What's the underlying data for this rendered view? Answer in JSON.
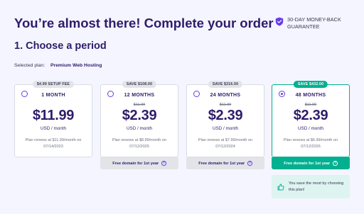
{
  "header": {
    "title": "You’re almost there! Complete your order",
    "guarantee_text": "30-DAY MONEY-BACK GUARANTEE"
  },
  "section": {
    "title": "1. Choose a period",
    "selected_plan_label": "Selected plan:",
    "selected_plan_name": "Premium Web Hosting"
  },
  "plans": [
    {
      "badge": "$4.99 SETUP FEE",
      "period": "1 MONTH",
      "old_price": "",
      "price": "$11.99",
      "unit": "USD / month",
      "renews": "Plan renews at $11.99/month on 07/14/2023",
      "domain": "",
      "selected": false
    },
    {
      "badge": "SAVE $108.00",
      "period": "12 MONTHS",
      "old_price": "$11.99",
      "price": "$2.39",
      "unit": "USD / month",
      "renews": "Plan renews at $8.99/month on 07/12/2025",
      "domain": "Free domain for 1st year",
      "selected": false
    },
    {
      "badge": "SAVE $216.00",
      "period": "24 MONTHS",
      "old_price": "$11.99",
      "price": "$2.39",
      "unit": "USD / month",
      "renews": "Plan renews at $7.99/month on 07/12/2024",
      "domain": "Free domain for 1st year",
      "selected": false
    },
    {
      "badge": "SAVE $432.00",
      "period": "48 MONTHS",
      "old_price": "$11.99",
      "price": "$2.39",
      "unit": "USD / month",
      "renews": "Plan renews at $6.99/month on 07/12/2026",
      "domain": "Free domain for 1st year",
      "selected": true
    }
  ],
  "save_note": "You save the most by choosing this plan!",
  "colors": {
    "brand": "#673de6",
    "title": "#2f1c6a",
    "accent_green": "#00b090",
    "background": "#f4f5ff"
  },
  "icons": {
    "guarantee": "shield-check-icon",
    "info": "info-icon",
    "note": "thumbs-up-icon"
  }
}
